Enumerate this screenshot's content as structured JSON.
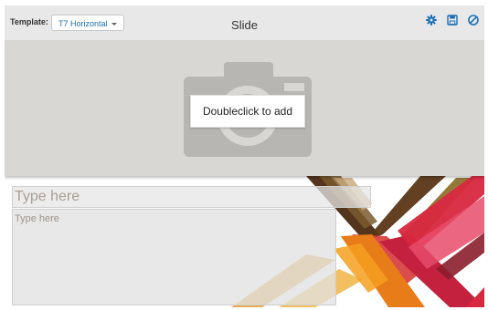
{
  "toolbar": {
    "template_label": "Template:",
    "template_value": "T7 Horizontal",
    "slide_title": "Slide",
    "icons": [
      "gear-icon",
      "save-icon",
      "disable-icon"
    ],
    "icon_color": "#1b6fb5"
  },
  "slide": {
    "image_placeholder": {
      "button_label": "Doubleclick to add",
      "icon": "camera-icon"
    },
    "title_field": {
      "placeholder": "Type here"
    },
    "body_field": {
      "placeholder": "Type here"
    }
  }
}
